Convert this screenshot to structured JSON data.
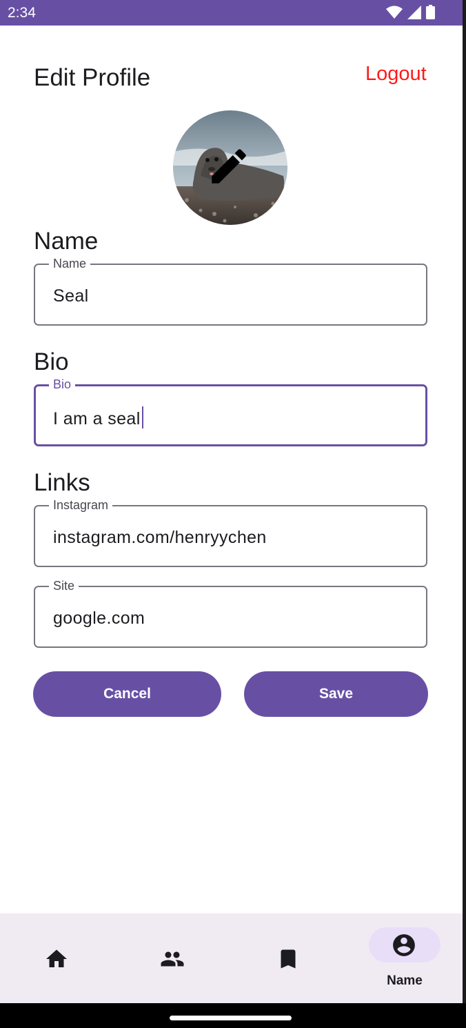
{
  "status_bar": {
    "time": "2:34",
    "icons": [
      "wifi-icon",
      "signal-icon",
      "battery-icon"
    ]
  },
  "header": {
    "title": "Edit Profile",
    "logout_label": "Logout"
  },
  "avatar": {
    "icon": "pencil-icon"
  },
  "sections": {
    "name": {
      "heading": "Name",
      "field": {
        "label": "Name",
        "value": "Seal"
      }
    },
    "bio": {
      "heading": "Bio",
      "field": {
        "label": "Bio",
        "value": "I am a seal"
      }
    },
    "links": {
      "heading": "Links",
      "instagram": {
        "label": "Instagram",
        "value": "instagram.com/henryychen"
      },
      "site": {
        "label": "Site",
        "value": "google.com"
      }
    }
  },
  "buttons": {
    "cancel_label": "Cancel",
    "save_label": "Save"
  },
  "bottom_nav": {
    "items": [
      {
        "icon": "home-icon"
      },
      {
        "icon": "people-icon"
      },
      {
        "icon": "bookmark-icon"
      },
      {
        "icon": "account-icon",
        "label": "Name",
        "selected": true
      }
    ]
  },
  "colors": {
    "primary": "#6750a4",
    "logout": "#ff1a1a",
    "nav_background": "#f0ebf3",
    "nav_selected_pill": "#e8def8"
  }
}
